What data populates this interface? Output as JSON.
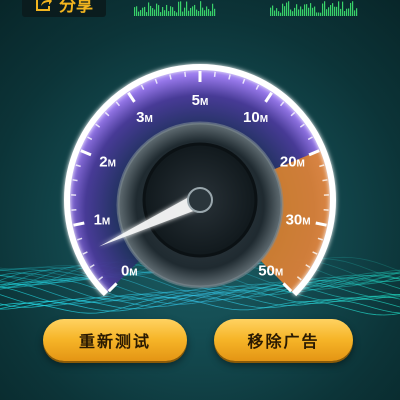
{
  "header": {
    "share_label": "分享",
    "share_icon": "share-icon"
  },
  "gauge": {
    "unit_suffix": "M",
    "ticks": [
      "0",
      "1",
      "2",
      "3",
      "5",
      "10",
      "20",
      "30",
      "50"
    ],
    "current_value_mbps": 0.6,
    "accent_color": "#e8892a",
    "arc_color": "#ffffff",
    "dial_glow_color": "#8a5cf0"
  },
  "actions": {
    "retest_label": "重新测试",
    "remove_ads_label": "移除广告"
  },
  "colors": {
    "button_gold": "#f6b528",
    "background": "#0d3a3e",
    "graph_green": "#39d36a"
  }
}
